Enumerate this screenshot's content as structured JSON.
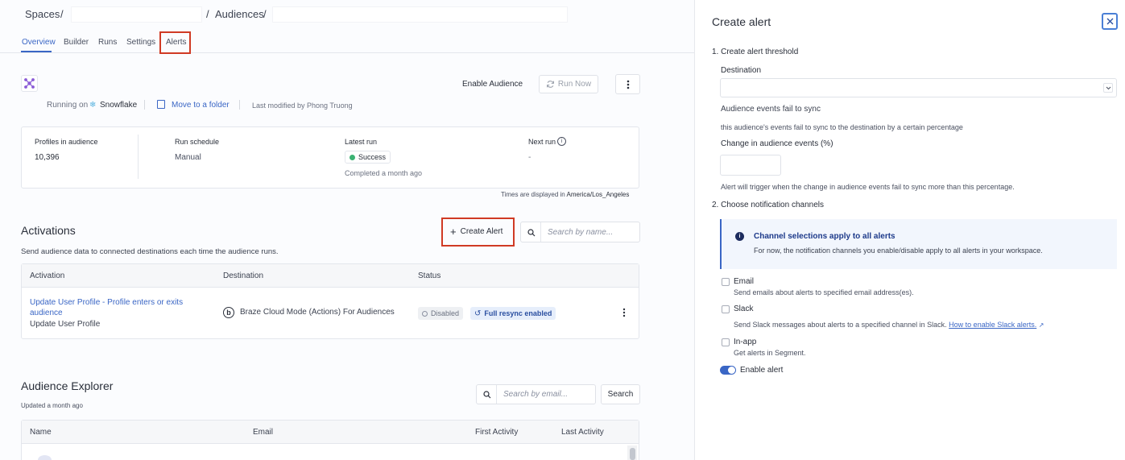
{
  "breadcrumb": {
    "spaces": "Spaces",
    "sep1": "/",
    "audiences": "Audiences",
    "sep2": "/"
  },
  "tabs": [
    {
      "label": "Overview",
      "active": true
    },
    {
      "label": "Builder",
      "active": false
    },
    {
      "label": "Runs",
      "active": false
    },
    {
      "label": "Settings",
      "active": false
    },
    {
      "label": "Alerts",
      "active": false
    }
  ],
  "header": {
    "enable_audience": "Enable Audience",
    "run_now": "Run Now",
    "running_on_label": "Running on",
    "running_on_value": "Snowflake",
    "move_to_folder": "Move to a folder",
    "last_modified": "Last modified by Phong Truong"
  },
  "stats": {
    "profiles_label": "Profiles in audience",
    "profiles_value": "10,396",
    "schedule_label": "Run schedule",
    "schedule_value": "Manual",
    "latest_label": "Latest run",
    "latest_status": "Success",
    "latest_sub": "Completed a month ago",
    "next_label": "Next run",
    "next_value": "-",
    "tz_prefix": "Times are displayed in",
    "tz_value": "America/Los_Angeles"
  },
  "activations": {
    "title": "Activations",
    "description": "Send audience data to connected destinations each time the audience runs.",
    "create_alert": "Create Alert",
    "search_placeholder": "Search by name...",
    "columns": [
      "Activation",
      "Destination",
      "Status"
    ],
    "rows": [
      {
        "name": "Update User Profile - Profile enters or exits audience",
        "sub": "Update User Profile",
        "destination": "Braze Cloud Mode (Actions) For Audiences",
        "status_disabled": "Disabled",
        "status_resync": "Full resync enabled"
      }
    ]
  },
  "explorer": {
    "title": "Audience Explorer",
    "updated": "Updated a month ago",
    "search_placeholder": "Search by email...",
    "search_button": "Search",
    "columns": [
      "Name",
      "Email",
      "First Activity",
      "Last Activity"
    ]
  },
  "panel": {
    "title": "Create alert",
    "step1": "1. Create alert threshold",
    "destination_label": "Destination",
    "destination_value": "",
    "events_fail": "Audience events fail to sync",
    "events_fail_desc": "this audience's events fail to sync to the destination by a certain percentage",
    "change_label": "Change in audience events (%)",
    "change_value": "",
    "trigger_desc": "Alert will trigger when the change in audience events fail to sync more than this percentage.",
    "step2": "2. Choose notification channels",
    "info_title": "Channel selections apply to all alerts",
    "info_desc": "For now, the notification channels you enable/disable apply to all alerts in your workspace.",
    "email_label": "Email",
    "email_desc": "Send emails about alerts to specified email address(es).",
    "slack_label": "Slack",
    "slack_desc": "Send Slack messages about alerts to a specified channel in Slack.",
    "slack_link": "How to enable Slack alerts.",
    "inapp_label": "In-app",
    "inapp_desc": "Get alerts in Segment.",
    "enable_alert": "Enable alert",
    "enable_alert_on": true
  },
  "colors": {
    "accent": "#3a66c5",
    "highlight": "#d03a24",
    "success": "#3bb273"
  }
}
